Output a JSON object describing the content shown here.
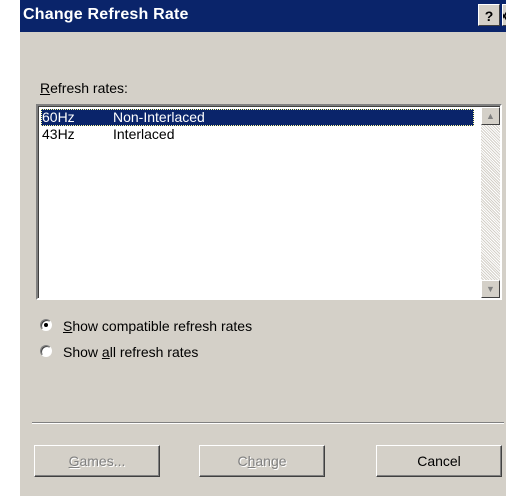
{
  "window": {
    "title": "Change Refresh Rate",
    "help_glyph": "?",
    "close_glyph": "X"
  },
  "list": {
    "label_accel": "R",
    "label_rest": "efresh rates:",
    "rows": [
      {
        "rate": "60Hz",
        "mode": "Non-Interlaced",
        "selected": true
      },
      {
        "rate": "43Hz",
        "mode": "Interlaced",
        "selected": false
      }
    ],
    "scroll_up_glyph": "▲",
    "scroll_down_glyph": "▼"
  },
  "options": {
    "compatible": {
      "accel": "S",
      "rest": "how compatible refresh rates",
      "checked": true
    },
    "all": {
      "pre": "Show ",
      "accel": "a",
      "rest": "ll refresh rates",
      "checked": false
    }
  },
  "buttons": {
    "games": {
      "accel": "G",
      "rest": "ames...",
      "enabled": false
    },
    "change": {
      "pre": "C",
      "accel": "h",
      "rest": "ange",
      "enabled": false
    },
    "cancel": {
      "label": "Cancel",
      "enabled": true
    }
  },
  "colors": {
    "title_bar": "#0a246a",
    "face": "#d4d0c8",
    "selection": "#0a246a"
  }
}
